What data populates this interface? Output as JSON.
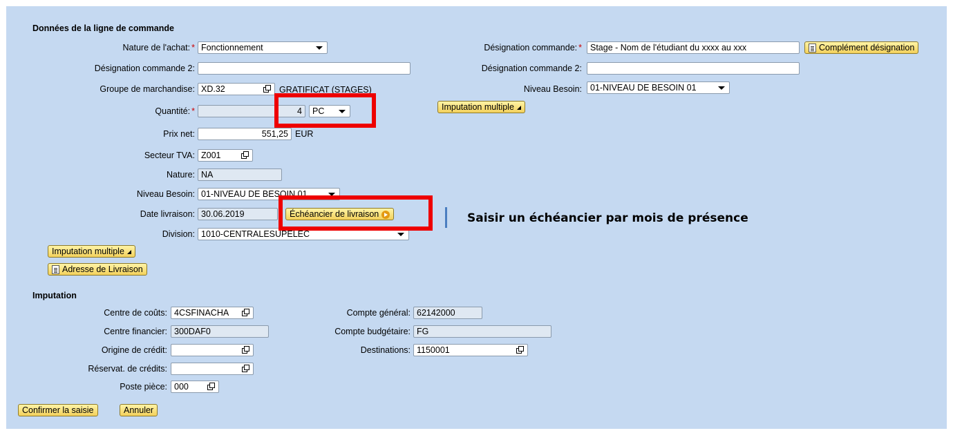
{
  "section_order": {
    "title": "Données de la ligne de commande",
    "nature_achat": {
      "label": "Nature de l'achat:",
      "value": "Fonctionnement"
    },
    "designation_commande": {
      "label": "Désignation commande:",
      "value": "Stage - Nom de l'étudiant du xxxx au xxx"
    },
    "complement_designation": "Complément désignation",
    "designation_commande_2_left": {
      "label": "Désignation commande 2:",
      "value": ""
    },
    "designation_commande_2_right": {
      "label": "Désignation commande 2:",
      "value": ""
    },
    "groupe_marchandise": {
      "label": "Groupe de marchandise:",
      "value": "XD.32",
      "description": "GRATIFICAT (STAGES)"
    },
    "niveau_besoin_right": {
      "label": "Niveau Besoin:",
      "value": "01-NIVEAU DE BESOIN 01"
    },
    "imputation_multiple_right": "Imputation multiple",
    "quantite": {
      "label": "Quantité:",
      "value": "4",
      "unit": "PC"
    },
    "prix_net": {
      "label": "Prix net:",
      "value": "551,25",
      "currency": "EUR"
    },
    "secteur_tva": {
      "label": "Secteur TVA:",
      "value": "Z001"
    },
    "nature": {
      "label": "Nature:",
      "value": "NA"
    },
    "niveau_besoin_left": {
      "label": "Niveau Besoin:",
      "value": "01-NIVEAU DE BESOIN 01"
    },
    "date_livraison": {
      "label": "Date livraison:",
      "value": "30.06.2019"
    },
    "echeancier": "Échéancier de livraison",
    "annotation": "Saisir un échéancier par mois de présence",
    "division": {
      "label": "Division:",
      "value": "1010-CENTRALESUPELEC"
    },
    "imputation_multiple_left": "Imputation multiple",
    "adresse_livraison": "Adresse de Livraison"
  },
  "imputation": {
    "title": "Imputation",
    "centre_couts": {
      "label": "Centre de coûts:",
      "value": "4CSFINACHA"
    },
    "compte_general": {
      "label": "Compte général:",
      "value": "62142000"
    },
    "centre_financier": {
      "label": "Centre financier:",
      "value": "300DAF0"
    },
    "compte_budgetaire": {
      "label": "Compte budgétaire:",
      "value": "FG"
    },
    "origine_credit": {
      "label": "Origine de crédit:",
      "value": ""
    },
    "destinations": {
      "label": "Destinations:",
      "value": "1150001"
    },
    "reservat_credits": {
      "label": "Réservat. de crédits:",
      "value": ""
    },
    "poste_piece": {
      "label": "Poste pièce:",
      "value": "000"
    }
  },
  "actions": {
    "confirm": "Confirmer la saisie",
    "cancel": "Annuler"
  },
  "colors": {
    "panel_bg": "#c5d9f1",
    "button_gold": "#f3d15c",
    "highlight_red": "#ee0000",
    "required_star": "#cc0000"
  }
}
